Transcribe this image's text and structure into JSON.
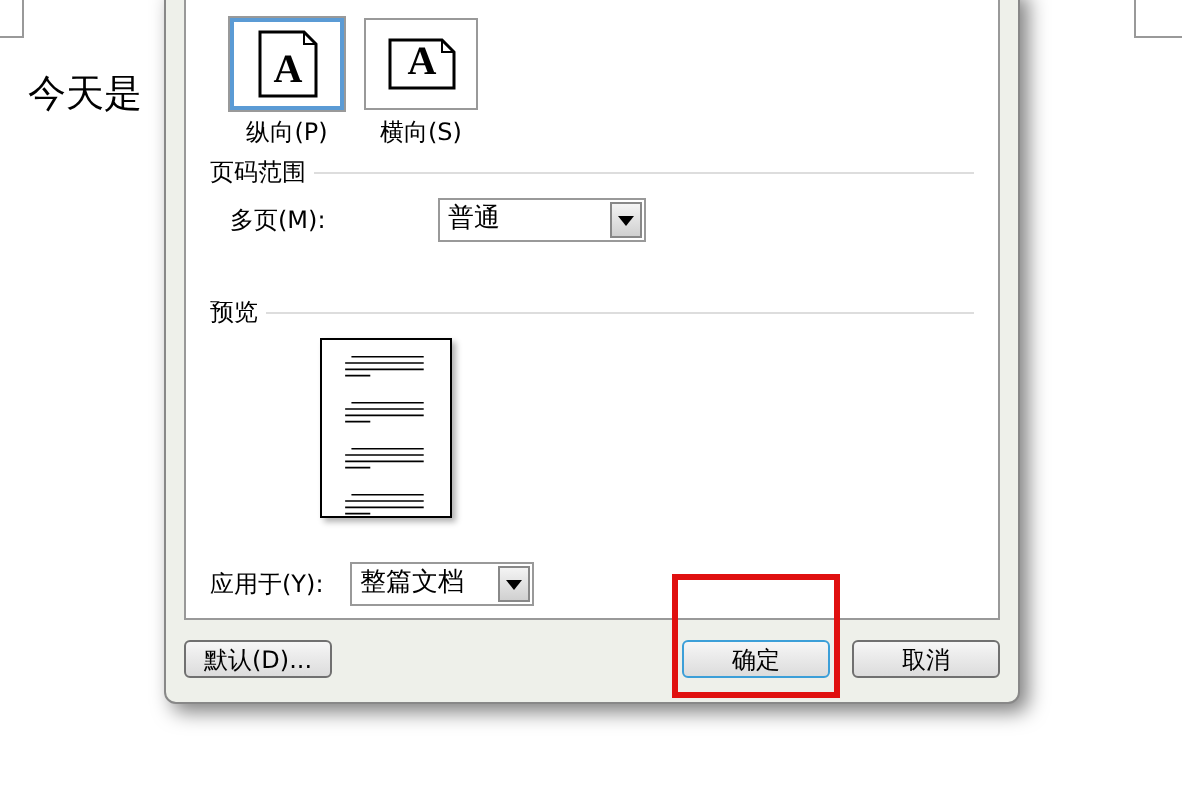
{
  "document": {
    "text": "今天是"
  },
  "orientation": {
    "options": [
      {
        "label": "纵向(P)",
        "kind": "portrait",
        "selected": true,
        "icon_letter": "A"
      },
      {
        "label": "横向(S)",
        "kind": "landscape",
        "selected": false,
        "icon_letter": "A"
      }
    ]
  },
  "page_range": {
    "title": "页码范围",
    "field_label": "多页(M):",
    "value": "普通"
  },
  "preview": {
    "title": "预览"
  },
  "apply_to": {
    "label": "应用于(Y):",
    "value": "整篇文档"
  },
  "buttons": [
    {
      "label": "默认(D)...",
      "kind": "left",
      "highlighted": false
    },
    {
      "label": "确定",
      "kind": "right",
      "highlighted": true
    },
    {
      "label": "取消",
      "kind": "right",
      "highlighted": false
    }
  ]
}
